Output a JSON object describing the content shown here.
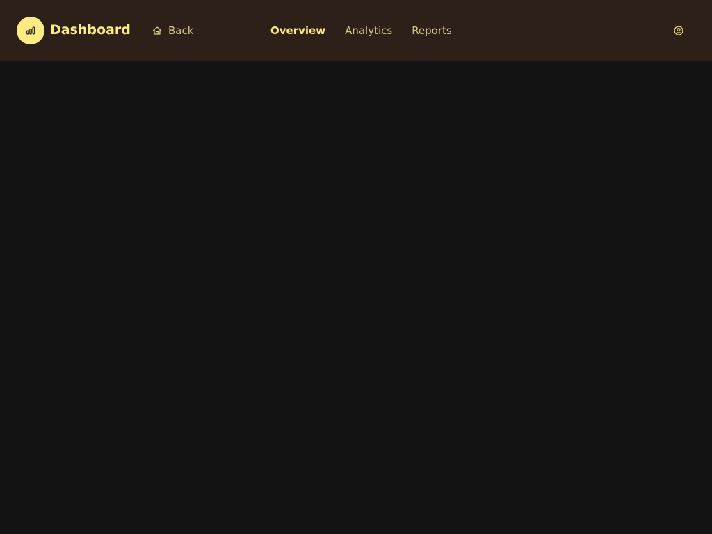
{
  "header": {
    "title": "Dashboard",
    "back_label": "Back",
    "nav": [
      {
        "label": "Overview",
        "active": true
      },
      {
        "label": "Analytics",
        "active": false
      },
      {
        "label": "Reports",
        "active": false
      }
    ]
  },
  "icons": {
    "logo": "bar-chart-icon",
    "back": "home-icon",
    "user": "user-circle-icon"
  },
  "colors": {
    "header_bg": "#2d2019",
    "page_bg": "#131313",
    "accent": "#fdeb86",
    "muted_text": "#d9c68a"
  }
}
